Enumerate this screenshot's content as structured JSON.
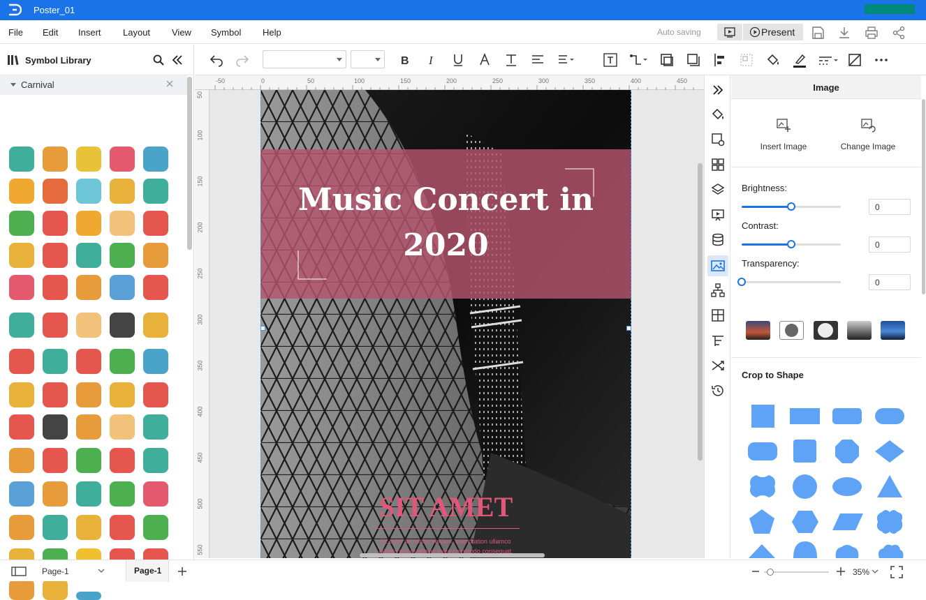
{
  "app": {
    "doc_title": "Poster_01"
  },
  "menu": [
    "File",
    "Edit",
    "Insert",
    "Layout",
    "View",
    "Symbol",
    "Help"
  ],
  "header": {
    "auto_saving": "Auto saving",
    "present_label": "Present"
  },
  "library": {
    "title": "Symbol Library",
    "category": "Carnival"
  },
  "toolbar": {
    "font_name": "",
    "font_size": ""
  },
  "poster": {
    "title_line1": "Music Concert in",
    "title_line2": "2020",
    "subtitle": "SIT AMET",
    "body_line1": "Ut enim ad minim veniam, exercitation ullamco",
    "body_line2": "laboris nisi ut aliquip exea commodo consequat."
  },
  "ruler": {
    "h_ticks": [
      "-50",
      "0",
      "50",
      "100",
      "150",
      "200",
      "250",
      "300",
      "350",
      "400",
      "450"
    ],
    "v_ticks": [
      "50",
      "100",
      "150",
      "200",
      "250",
      "300",
      "350",
      "400",
      "450",
      "500",
      "550"
    ]
  },
  "panel": {
    "title": "Image",
    "insert_image": "Insert Image",
    "change_image": "Change Image",
    "brightness_label": "Brightness:",
    "brightness_value": "0",
    "contrast_label": "Contrast:",
    "contrast_value": "0",
    "transparency_label": "Transparency:",
    "transparency_value": "0",
    "crop_title": "Crop to Shape"
  },
  "status": {
    "page_select": "Page-1",
    "page_tab": "Page-1",
    "zoom": "35%"
  },
  "colors": {
    "accent": "#1a73e8",
    "poster_band": "#b5546c",
    "poster_text_pink": "#e0577a",
    "shape_fill": "#5ea3f5"
  }
}
